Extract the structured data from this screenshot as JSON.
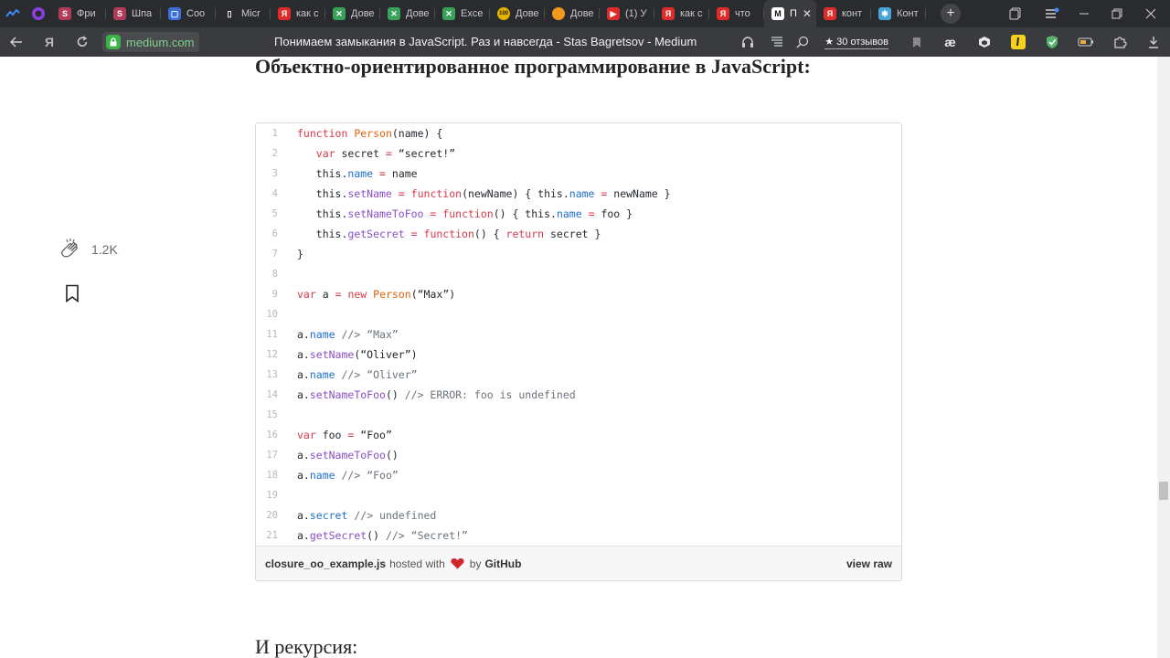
{
  "tabs": [
    {
      "label": "Фри",
      "icon": "pdf-icon",
      "color": "#b23b5a",
      "glyph": "S"
    },
    {
      "label": "Шпа",
      "icon": "pdf-icon",
      "color": "#b23b5a",
      "glyph": "S"
    },
    {
      "label": "Соо",
      "icon": "chat-icon",
      "color": "#3d6fd9",
      "glyph": "▢"
    },
    {
      "label": "Micr",
      "icon": "document-icon",
      "color": "#2a2b2e",
      "glyph": "▯"
    },
    {
      "label": "как с",
      "icon": "yandex-icon",
      "color": "#e02b2b",
      "glyph": "Я"
    },
    {
      "label": "Дове",
      "icon": "excel-icon",
      "color": "#3aa15a",
      "glyph": "✕"
    },
    {
      "label": "Дове",
      "icon": "excel-icon",
      "color": "#3aa15a",
      "glyph": "✕"
    },
    {
      "label": "Exce",
      "icon": "excel-icon",
      "color": "#3aa15a",
      "glyph": "✕"
    },
    {
      "label": "Дове",
      "icon": "cent-icon",
      "color": "#e3b300",
      "glyph": "100"
    },
    {
      "label": "Дове",
      "icon": "circle-icon",
      "color": "#f39a1e",
      "glyph": ""
    },
    {
      "label": "(1) У",
      "icon": "youtube-icon",
      "color": "#e02b2b",
      "glyph": "▶"
    },
    {
      "label": "как с",
      "icon": "yandex-icon",
      "color": "#e02b2b",
      "glyph": "Я"
    },
    {
      "label": "что",
      "icon": "yandex-icon",
      "color": "#e02b2b",
      "glyph": "Я"
    },
    {
      "label": "П",
      "icon": "medium-icon",
      "color": "#ffffff",
      "glyph": "M",
      "active": true
    },
    {
      "label": "конт",
      "icon": "yandex-icon",
      "color": "#e02b2b",
      "glyph": "Я"
    },
    {
      "label": "Конт",
      "icon": "puzzle-icon",
      "color": "#4aa3d9",
      "glyph": "✱"
    }
  ],
  "address": {
    "domain": "medium.com",
    "title": "Понимаем замыкания в JavaScript. Раз и навсегда - Stas Bagretsov - Medium",
    "reviews": "★ 30 отзывов"
  },
  "article": {
    "heading": "Объектно-ориентированное программирование в JavaScript:",
    "next_heading": "И рекурсия:",
    "clap_count": "1.2K"
  },
  "gist": {
    "filename": "closure_oo_example.js",
    "hosted_text": "hosted with",
    "by_text": "by",
    "github": "GitHub",
    "view_raw": "view raw",
    "lines": [
      "function Person(name) {",
      "   var secret = “secret!”",
      "   this.name = name",
      "   this.setName = function(newName) { this.name = newName }",
      "   this.setNameToFoo = function() { this.name = foo }",
      "   this.getSecret = function() { return secret }",
      "}",
      "",
      "var a = new Person(“Max”)",
      "",
      "a.name //> “Max”",
      "a.setName(“Oliver”)",
      "a.name //> “Oliver”",
      "a.setNameToFoo() //> ERROR: foo is undefined",
      "",
      "var foo = “Foo”",
      "a.setNameToFoo()",
      "a.name //> “Foo”",
      "",
      "a.secret //> undefined",
      "a.getSecret() //> “Secret!”"
    ]
  }
}
